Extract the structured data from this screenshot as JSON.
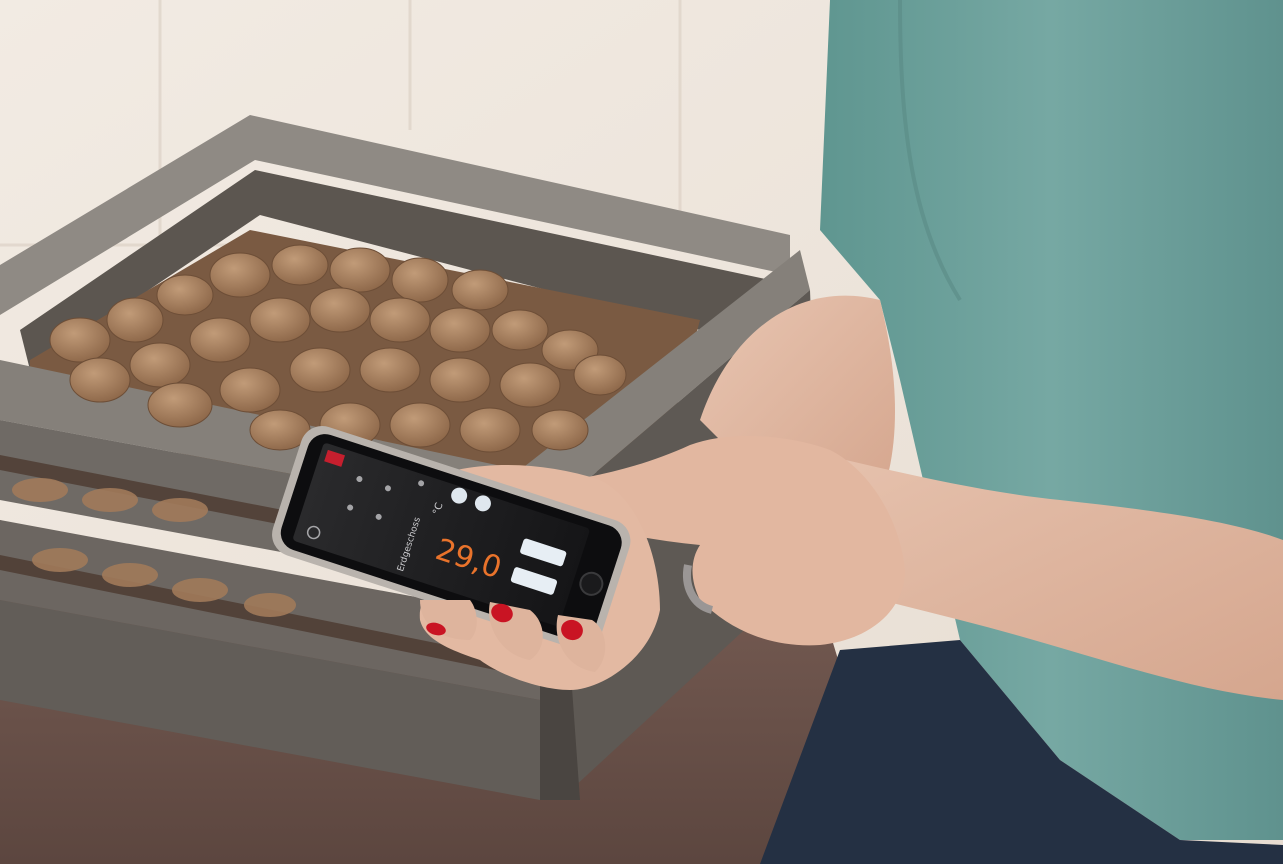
{
  "photo": {
    "palette": {
      "wall": "#efe6dc",
      "floor": "#6a5048",
      "crate_wood": "#7d7872",
      "potato": "#a7805f",
      "shirt": "#6f9f9a",
      "skin": "#e0b7a1",
      "nail_polish": "#c91423",
      "jeans": "#243043",
      "phone_screen": "#1b1b1d",
      "app_accent": "#e9732b"
    }
  },
  "phone_app": {
    "temperature": "29,0",
    "unit": "°C",
    "mode_label": "Erdgeschoss",
    "badge_color": "#c61f2e"
  }
}
